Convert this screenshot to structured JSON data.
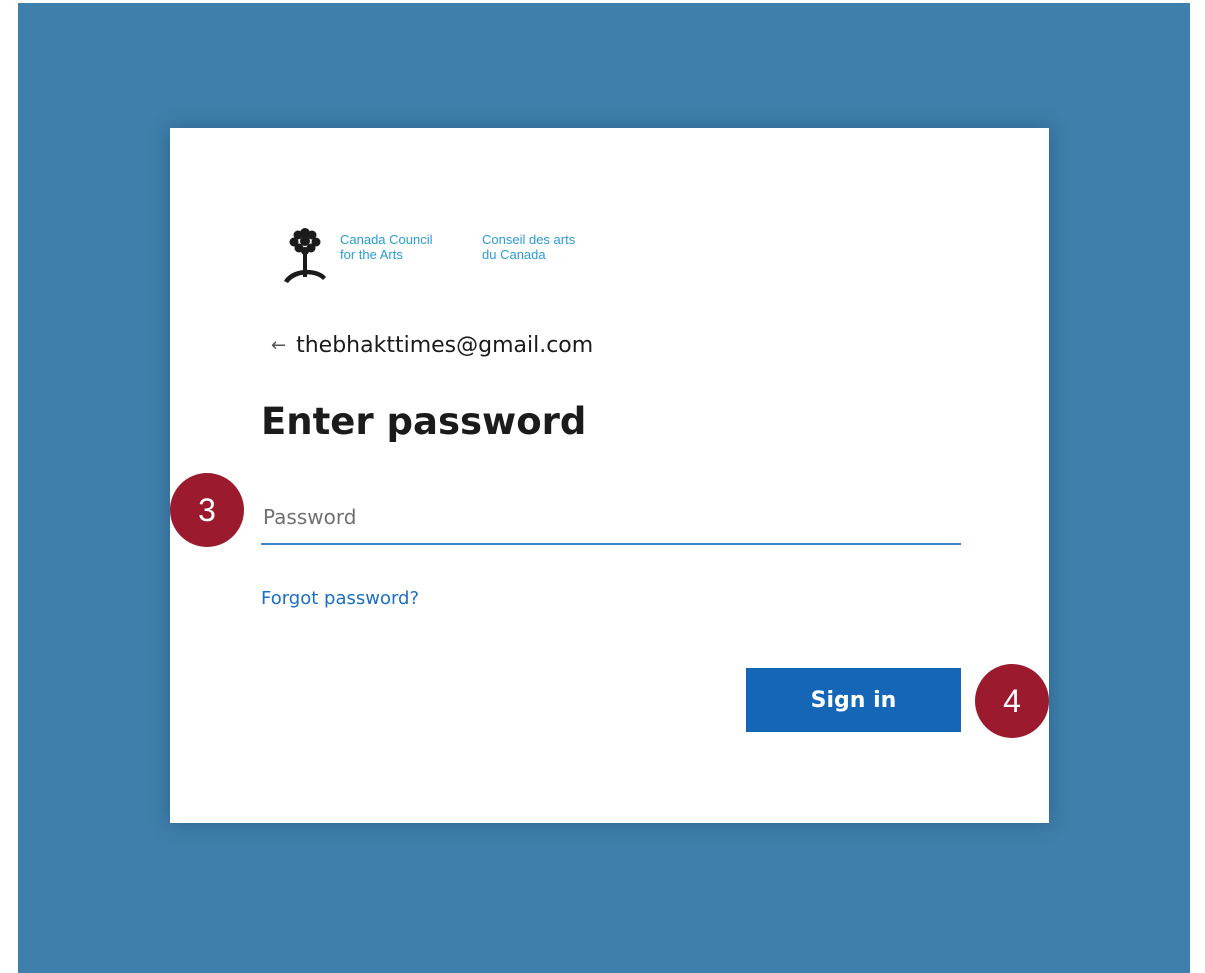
{
  "brand": {
    "name_en_line1": "Canada Council",
    "name_en_line2": "for the Arts",
    "name_fr_line1": "Conseil des arts",
    "name_fr_line2": "du Canada",
    "logo_icon": "tree-icon",
    "color": "#2a9bd6"
  },
  "identity": {
    "back_icon": "back-arrow-icon",
    "back_glyph": "←",
    "email": "thebhakttimes@gmail.com"
  },
  "title": "Enter password",
  "password": {
    "placeholder": "Password",
    "value": ""
  },
  "forgot_password_label": "Forgot password?",
  "signin_label": "Sign in",
  "step_badges": {
    "password_step": "3",
    "signin_step": "4"
  },
  "colors": {
    "backdrop": "#3e7fab",
    "accent": "#1666b8",
    "link": "#1b6ec2",
    "badge": "#9b1a2e"
  }
}
